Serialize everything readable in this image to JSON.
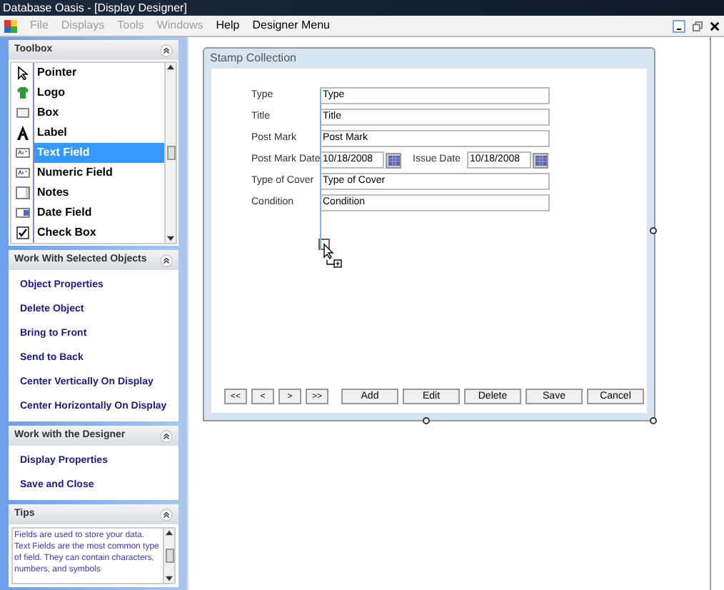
{
  "window": {
    "title": "Database Oasis - [Display Designer]"
  },
  "menu": [
    {
      "label": "File",
      "disabled": true
    },
    {
      "label": "Displays",
      "disabled": true
    },
    {
      "label": "Tools",
      "disabled": true
    },
    {
      "label": "Windows",
      "disabled": true
    },
    {
      "label": "Help",
      "disabled": false
    },
    {
      "label": "Designer Menu",
      "disabled": false
    }
  ],
  "toolbox": {
    "title": "Toolbox",
    "items": [
      {
        "label": "Pointer",
        "kind": "pointer",
        "selected": false
      },
      {
        "label": "Logo",
        "kind": "logo",
        "selected": false
      },
      {
        "label": "Box",
        "kind": "box",
        "selected": false
      },
      {
        "label": "Label",
        "kind": "label",
        "selected": false
      },
      {
        "label": "Text Field",
        "kind": "text",
        "selected": true
      },
      {
        "label": "Numeric Field",
        "kind": "numeric",
        "selected": false
      },
      {
        "label": "Notes",
        "kind": "notes",
        "selected": false
      },
      {
        "label": "Date Field",
        "kind": "date",
        "selected": false
      },
      {
        "label": "Check Box",
        "kind": "check",
        "selected": false
      }
    ]
  },
  "panels": [
    {
      "title": "Work With Selected Objects",
      "links": [
        "Object Properties",
        "Delete Object",
        "Bring to Front",
        "Send to Back",
        "Center Vertically On Display",
        "Center Horizontally On Display"
      ]
    },
    {
      "title": "Work with the Designer",
      "links": [
        "Display Properties",
        "Save and Close"
      ]
    }
  ],
  "tips": {
    "title": "Tips",
    "text": "Fields are used to store your data. Text Fields are the most common type of field. They can contain characters, numbers, and symbols"
  },
  "display": {
    "title": "Stamp Collection",
    "rows": [
      {
        "kind": "text",
        "label": "Type",
        "value": "Type"
      },
      {
        "kind": "text",
        "label": "Title",
        "value": "Title"
      },
      {
        "kind": "text",
        "label": "Post Mark",
        "value": "Post Mark"
      },
      {
        "kind": "date_pair",
        "label": "Post Mark Date",
        "value": "10/18/2008",
        "label2": "Issue Date",
        "value2": "10/18/2008"
      },
      {
        "kind": "text",
        "label": "Type of Cover",
        "value": "Type of Cover"
      },
      {
        "kind": "text",
        "label": "Condition",
        "value": "Condition"
      }
    ],
    "nav_buttons": [
      "<<",
      "<",
      ">",
      ">>"
    ],
    "buttons": [
      "Add",
      "Edit",
      "Delete",
      "Save",
      "Cancel"
    ]
  }
}
